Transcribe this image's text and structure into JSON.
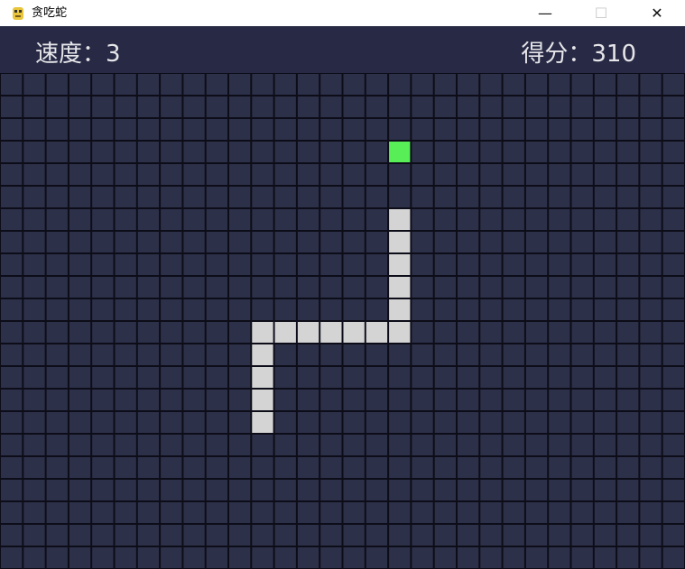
{
  "window": {
    "title": "贪吃蛇",
    "icon": "python-snake-icon",
    "controls": {
      "minimize": "—",
      "maximize": "☐",
      "close": "✕"
    }
  },
  "hud": {
    "speed_label": "速度：",
    "speed_value": "3",
    "score_label": "得分：",
    "score_value": "310"
  },
  "game": {
    "grid_cols": 30,
    "grid_rows": 22,
    "snake": [
      [
        17,
        6
      ],
      [
        17,
        7
      ],
      [
        17,
        8
      ],
      [
        17,
        9
      ],
      [
        17,
        10
      ],
      [
        17,
        11
      ],
      [
        16,
        11
      ],
      [
        15,
        11
      ],
      [
        14,
        11
      ],
      [
        13,
        11
      ],
      [
        12,
        11
      ],
      [
        11,
        11
      ],
      [
        11,
        12
      ],
      [
        11,
        13
      ],
      [
        11,
        14
      ],
      [
        11,
        15
      ]
    ],
    "food": [
      17,
      3
    ],
    "colors": {
      "background": "#282a45",
      "grid_cell": "#2d3049",
      "grid_line": "#0c0d18",
      "snake": "#d4d4d4",
      "food": "#58ee58",
      "hud_text": "#e6e6ea"
    }
  }
}
